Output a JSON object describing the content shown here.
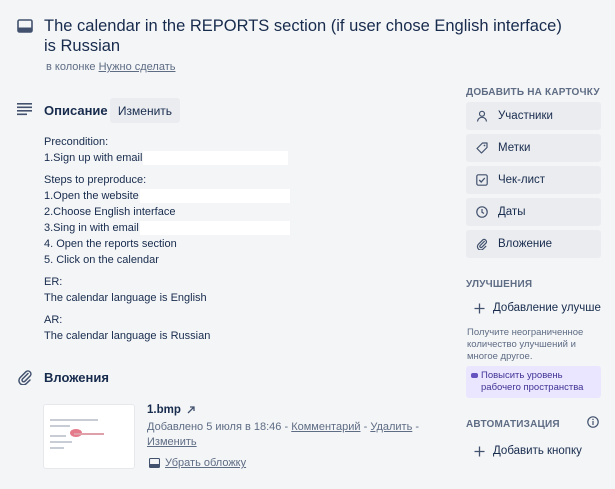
{
  "card": {
    "title": "The calendar in the REPORTS section (if user chose English interface) is Russian",
    "in_list_prefix": "в колонке",
    "list_name": "Нужно сделать"
  },
  "description": {
    "heading": "Описание",
    "edit_label": "Изменить",
    "lines": {
      "precondition": "Precondition:",
      "pre1": "1.Sign up with email",
      "steps": "Steps to preproduce:",
      "s1": "1.Open the website",
      "s2": "2.Choose English interface",
      "s3": "3.Sing in with email",
      "s4": "4. Open the reports section",
      "s5": "5. Click on the calendar",
      "er": "ER:",
      "er_text": "The calendar language is English",
      "ar": "AR:",
      "ar_text": "The calendar language is Russian"
    }
  },
  "attachments": {
    "heading": "Вложения",
    "file": {
      "name": "1.bmp",
      "added": "Добавлено 5 июля в 18:46",
      "sep": "-",
      "comment": "Комментарий",
      "delete": "Удалить",
      "edit": "Изменить",
      "remove_cover": "Убрать обложку"
    }
  },
  "sidebar": {
    "add_to_card_heading": "ДОБАВИТЬ НА КАРТОЧКУ",
    "add_items": [
      {
        "label": "Участники",
        "icon": "user-icon"
      },
      {
        "label": "Метки",
        "icon": "tag-icon"
      },
      {
        "label": "Чек-лист",
        "icon": "checklist-icon"
      },
      {
        "label": "Даты",
        "icon": "clock-icon"
      },
      {
        "label": "Вложение",
        "icon": "paperclip-icon"
      }
    ],
    "improvements_heading": "УЛУЧШЕНИЯ",
    "add_improvement": "Добавление улучшения",
    "promo": "Получите неограниченное количество улучшений и многое другое.",
    "upgrade": "Повысить уровень рабочего пространства",
    "automation_heading": "АВТОМАТИЗАЦИЯ",
    "add_button": "Добавить кнопку"
  },
  "colors": {
    "background": "#f4f5f7",
    "button_bg": "#ebecf0",
    "text": "#172b4d",
    "muted": "#5e6c84",
    "upgrade_bg": "#eae6ff",
    "upgrade_text": "#403294"
  }
}
